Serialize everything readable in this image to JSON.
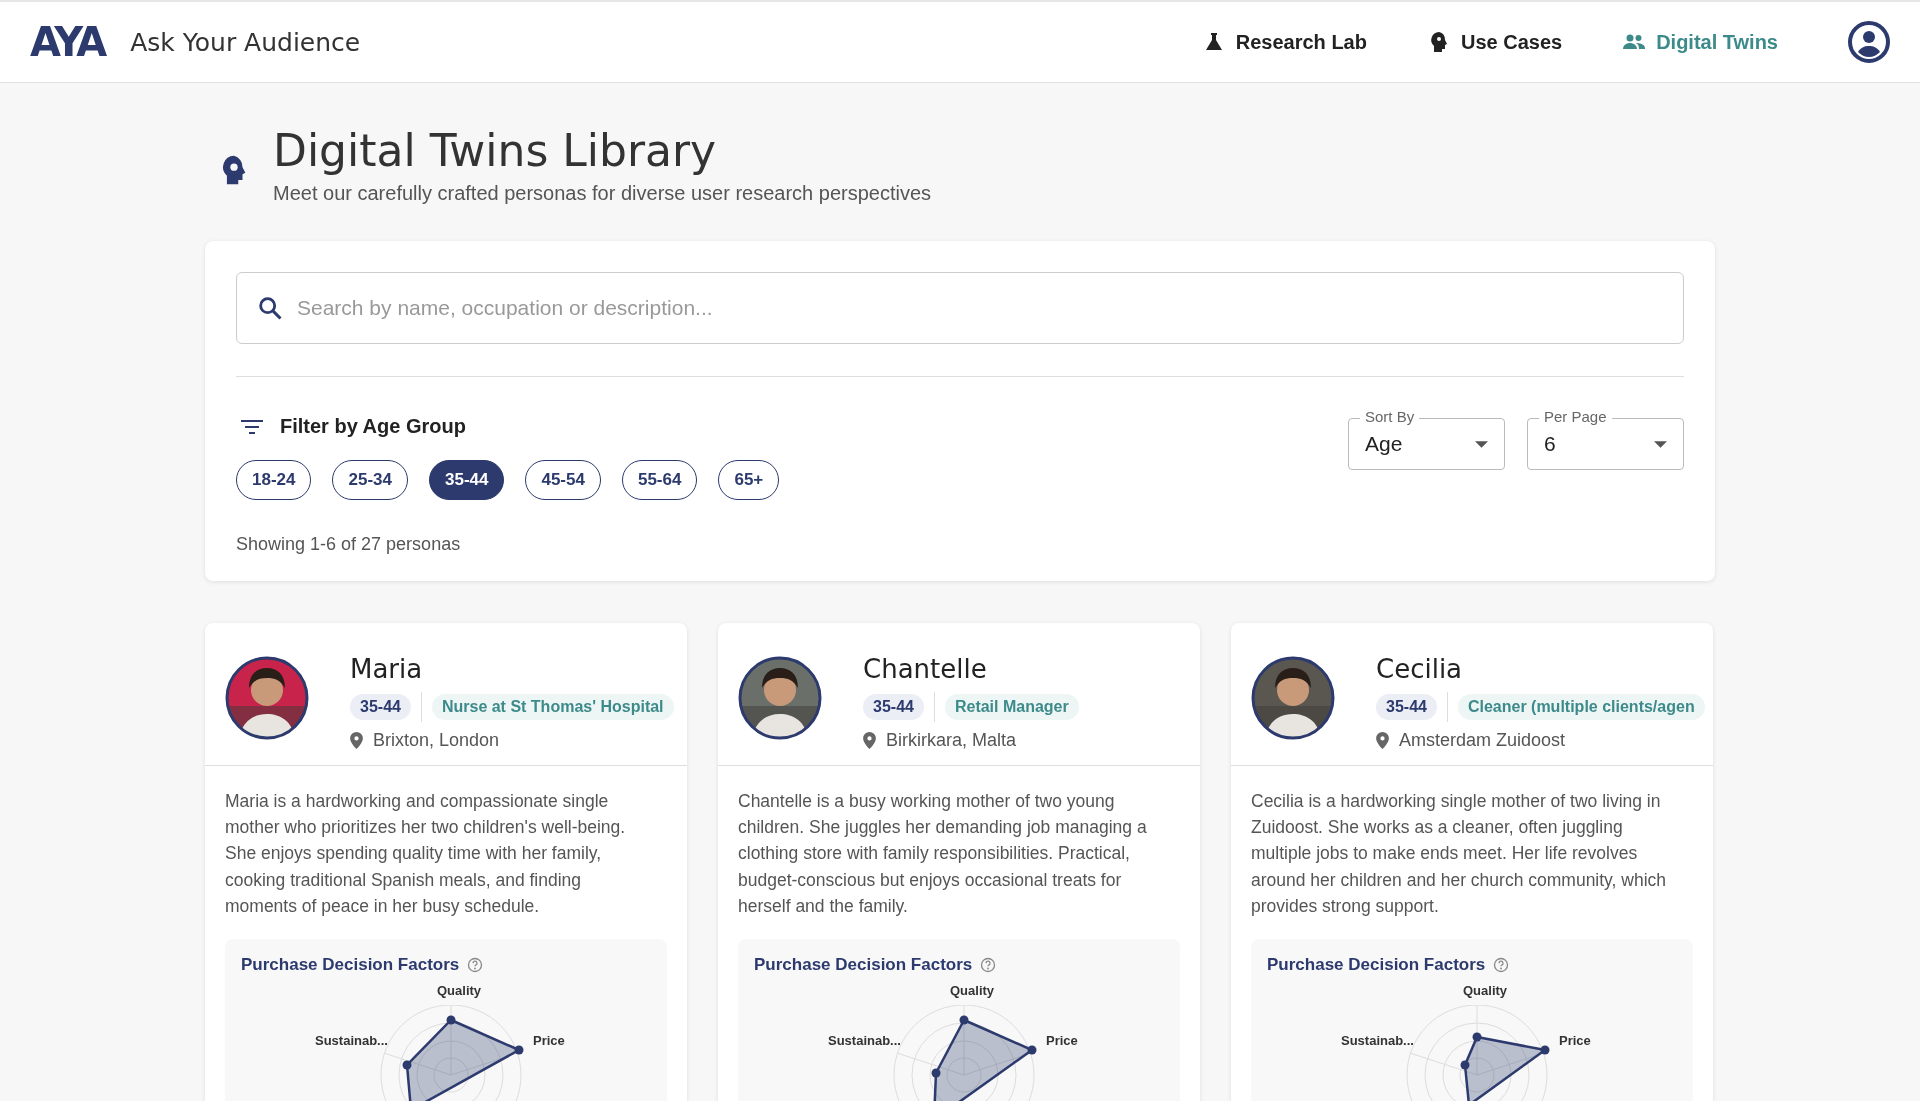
{
  "brand": {
    "logo": "AYA",
    "name": "Ask Your Audience"
  },
  "nav": [
    {
      "label": "Research Lab",
      "selected": false
    },
    {
      "label": "Use Cases",
      "selected": false
    },
    {
      "label": "Digital Twins",
      "selected": true
    }
  ],
  "page": {
    "title": "Digital Twins Library",
    "subtitle": "Meet our carefully crafted personas for diverse user research perspectives"
  },
  "search": {
    "placeholder": "Search by name, occupation or description..."
  },
  "filter": {
    "title": "Filter by Age Group",
    "chips": [
      {
        "label": "18-24",
        "selected": false
      },
      {
        "label": "25-34",
        "selected": false
      },
      {
        "label": "35-44",
        "selected": true
      },
      {
        "label": "45-54",
        "selected": false
      },
      {
        "label": "55-64",
        "selected": false
      },
      {
        "label": "65+",
        "selected": false
      }
    ],
    "showing": "Showing 1-6 of 27 personas"
  },
  "selects": [
    {
      "label": "Sort By",
      "value": "Age"
    },
    {
      "label": "Per Page",
      "value": "6"
    }
  ],
  "personas": [
    {
      "name": "Maria",
      "age": "35-44",
      "occupation": "Nurse at St Thomas' Hospital",
      "location": "Brixton, London",
      "description": "Maria is a hardworking and compassionate single mother who prioritizes her two children's well-being. She enjoys spending quality time with her family, cooking traditional Spanish meals, and finding moments of peace in her busy schedule.",
      "chart_title": "Purchase Decision Factors",
      "axes": [
        "Quality",
        "Price",
        "Sustainab..."
      ]
    },
    {
      "name": "Chantelle",
      "age": "35-44",
      "occupation": "Retail Manager",
      "location": "Birkirkara, Malta",
      "description": "Chantelle is a busy working mother of two young children. She juggles her demanding job managing a clothing store with family responsibilities. Practical, budget-conscious but enjoys occasional treats for herself and the family.",
      "chart_title": "Purchase Decision Factors",
      "axes": [
        "Quality",
        "Price",
        "Sustainab..."
      ]
    },
    {
      "name": "Cecilia",
      "age": "35-44",
      "occupation": "Cleaner (multiple clients/agen",
      "location": "Amsterdam Zuidoost",
      "description": "Cecilia is a hardworking single mother of two living in Zuidoost. She works as a cleaner, often juggling multiple jobs to make ends meet. Her life revolves around her children and her church community, which provides strong support.",
      "chart_title": "Purchase Decision Factors",
      "axes": [
        "Quality",
        "Price",
        "Sustainab..."
      ]
    }
  ]
}
